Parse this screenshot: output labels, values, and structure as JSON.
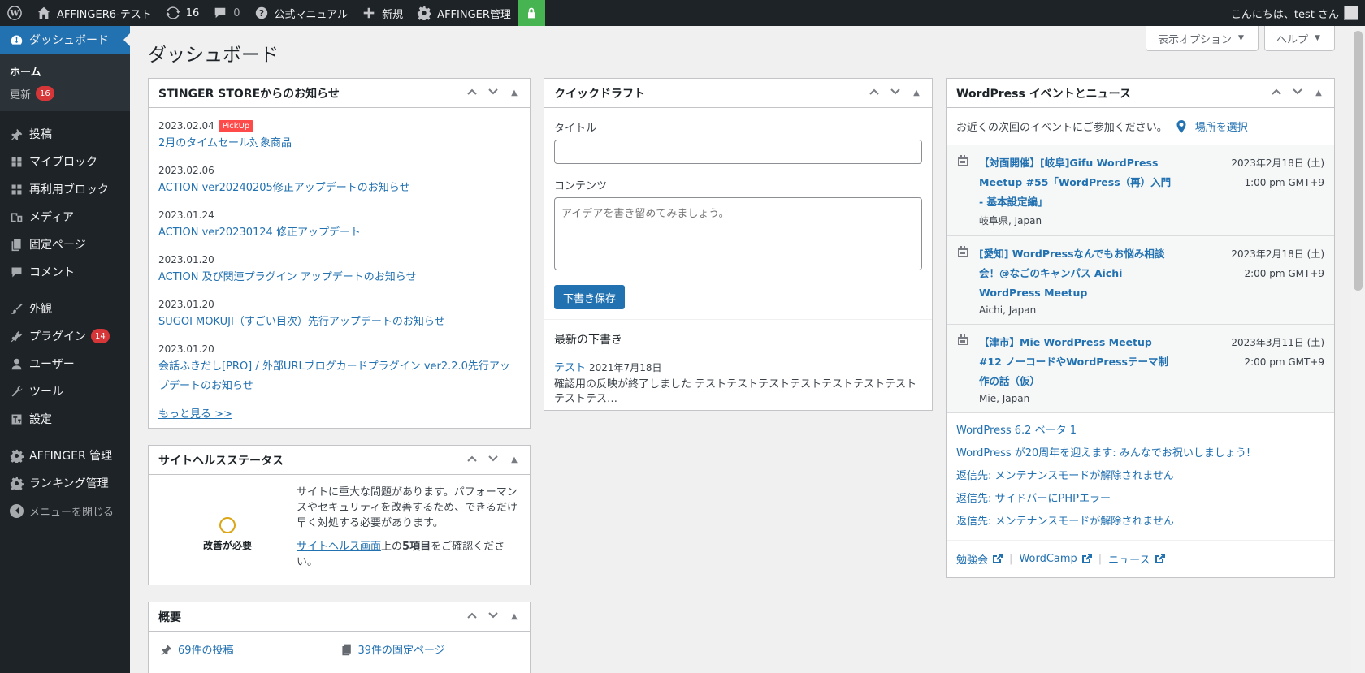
{
  "admin_bar": {
    "site_name": "AFFINGER6-テスト",
    "updates_count": "16",
    "comments_count": "0",
    "manual": "公式マニュアル",
    "new": "新規",
    "affinger_admin": "AFFINGER管理",
    "greeting": "こんにちは、test さん"
  },
  "sidebar": {
    "dashboard": "ダッシュボード",
    "sub_home": "ホーム",
    "sub_updates": "更新",
    "sub_updates_badge": "16",
    "items": [
      {
        "label": "投稿",
        "icon": "pushpin-icon"
      },
      {
        "label": "マイブロック",
        "icon": "grid-icon"
      },
      {
        "label": "再利用ブロック",
        "icon": "grid-icon"
      },
      {
        "label": "メディア",
        "icon": "media-icon"
      },
      {
        "label": "固定ページ",
        "icon": "page-icon"
      },
      {
        "label": "コメント",
        "icon": "comment-icon"
      },
      {
        "label": "外観",
        "icon": "brush-icon"
      },
      {
        "label": "プラグイン",
        "icon": "plugin-icon",
        "badge": "14"
      },
      {
        "label": "ユーザー",
        "icon": "user-icon"
      },
      {
        "label": "ツール",
        "icon": "wrench-icon"
      },
      {
        "label": "設定",
        "icon": "settings-icon"
      },
      {
        "label": "AFFINGER 管理",
        "icon": "gear-icon"
      },
      {
        "label": "ランキング管理",
        "icon": "gear-icon"
      }
    ],
    "collapse": "メニューを閉じる"
  },
  "screen_meta": {
    "options": "表示オプション",
    "help": "ヘルプ"
  },
  "page_title": "ダッシュボード",
  "news_box": {
    "title": "STINGER STOREからのお知らせ",
    "pickup": "PickUp",
    "items": [
      {
        "date": "2023.02.04",
        "title": "2月のタイムセール対象商品"
      },
      {
        "date": "2023.02.06",
        "title": "ACTION ver20240205修正アップデートのお知らせ"
      },
      {
        "date": "2023.01.24",
        "title": "ACTION ver20230124 修正アップデート"
      },
      {
        "date": "2023.01.20",
        "title": "ACTION 及び関連プラグイン アップデートのお知らせ"
      },
      {
        "date": "2023.01.20",
        "title": "SUGOI MOKUJI（すごい目次）先行アップデートのお知らせ"
      },
      {
        "date": "2023.01.20",
        "title": "会話ふきだし[PRO] / 外部URLブログカードプラグイン ver2.2.0先行アップデートのお知らせ"
      }
    ],
    "more": "もっと見る >>"
  },
  "site_health": {
    "title": "サイトヘルスステータス",
    "status": "改善が必要",
    "description": "サイトに重大な問題があります。パフォーマンスやセキュリティを改善するため、できるだけ早く対処する必要があります。",
    "link": "サイトヘルス画面",
    "after_link_pre": "上の",
    "count_bold": "5項目",
    "after_link_post": "をご確認ください。"
  },
  "glance": {
    "title": "概要",
    "posts": "69件の投稿",
    "pages": "39件の固定ページ"
  },
  "quick_draft": {
    "title": "クイックドラフト",
    "title_label": "タイトル",
    "content_label": "コンテンツ",
    "content_placeholder": "アイデアを書き留めてみましょう。",
    "save_button": "下書き保存",
    "recent_heading": "最新の下書き",
    "draft_title": "テスト",
    "draft_date": "2021年7月18日",
    "draft_excerpt": "確認用の反映が終了しました テストテストテストテストテストテストテスト テストテス…"
  },
  "events": {
    "title": "WordPress イベントとニュース",
    "intro": "お近くの次回のイベントにご参加ください。",
    "select_location": "場所を選択",
    "items": [
      {
        "title": "【対面開催】[岐阜]Gifu WordPress Meetup #55「WordPress（再）入門 - 基本設定編」",
        "place": "岐阜県, Japan",
        "date": "2023年2月18日 (土)",
        "time": "1:00 pm GMT+9"
      },
      {
        "title": "[愛知] WordPressなんでもお悩み相談会！@なごのキャンパス Aichi WordPress Meetup",
        "place": "Aichi, Japan",
        "date": "2023年2月18日 (土)",
        "time": "2:00 pm GMT+9"
      },
      {
        "title": "【津市】Mie WordPress Meetup #12 ノーコードやWordPressテーマ制作の話（仮）",
        "place": "Mie, Japan",
        "date": "2023年3月11日 (土)",
        "time": "2:00 pm GMT+9"
      }
    ],
    "news": [
      "WordPress 6.2 ベータ 1",
      "WordPress が20周年を迎えます: みんなでお祝いしましょう!",
      "返信先: メンテナンスモードが解除されません",
      "返信先: サイドバーにPHPエラー",
      "返信先: メンテナンスモードが解除されません"
    ],
    "footer": [
      "勉強会",
      "WordCamp",
      "ニュース"
    ]
  }
}
